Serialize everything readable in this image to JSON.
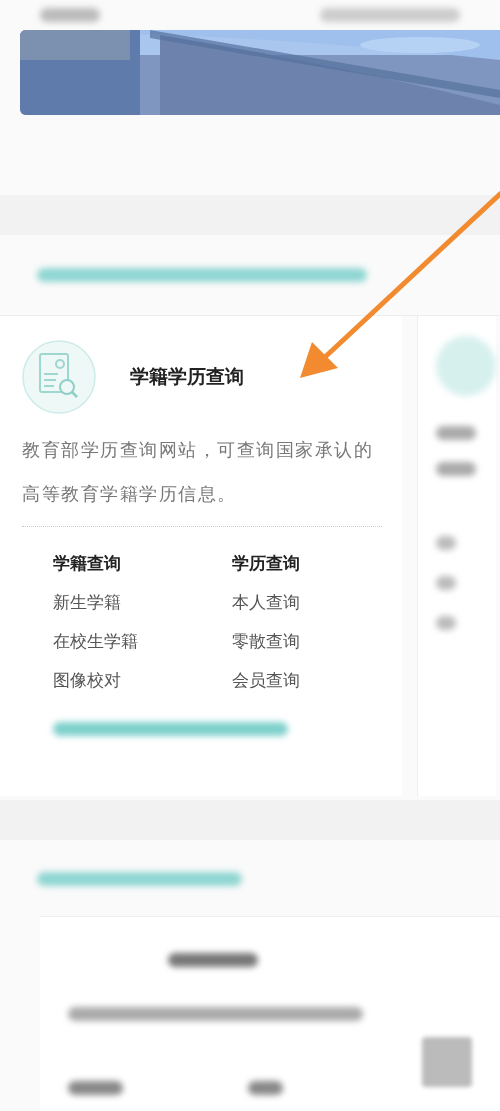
{
  "service_card": {
    "title": "学籍学历查询",
    "description": "教育部学历查询网站，可查询国家承认的高等教育学籍学历信息。",
    "links": [
      {
        "label": "学籍查询",
        "bold": true
      },
      {
        "label": "学历查询",
        "bold": true
      },
      {
        "label": "新生学籍",
        "bold": false
      },
      {
        "label": "本人查询",
        "bold": false
      },
      {
        "label": "在校生学籍",
        "bold": false
      },
      {
        "label": "零散查询",
        "bold": false
      },
      {
        "label": "图像校对",
        "bold": false
      },
      {
        "label": "会员查询",
        "bold": false
      }
    ]
  },
  "annotation": {
    "kind": "arrow",
    "color": "#f28a30"
  }
}
